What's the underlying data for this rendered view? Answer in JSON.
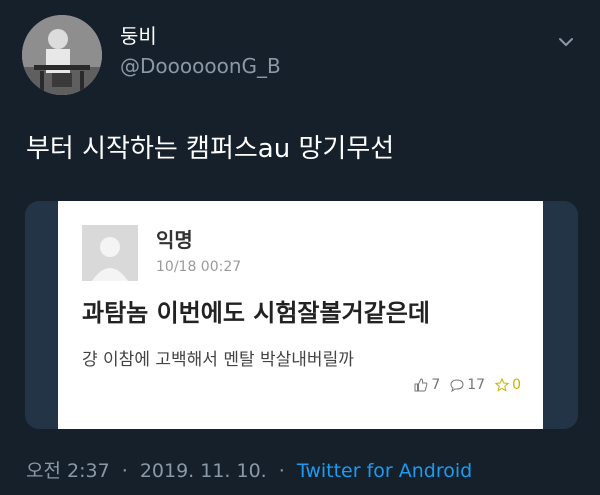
{
  "user": {
    "display_name": "둥비",
    "handle": "@DoooooonG_B"
  },
  "tweet": {
    "text": "부터 시작하는 캠퍼스au 망기무선",
    "time": "오전 2:37",
    "date": "2019. 11. 10.",
    "via": "Twitter for Android"
  },
  "card": {
    "author": "익명",
    "date": "10/18 00:27",
    "title": "과탐놈 이번에도 시험잘볼거같은데",
    "body": "걍 이참에 고백해서 멘탈 박살내버릴까",
    "likes": "7",
    "comments": "17",
    "scraps": "0"
  },
  "icons": {
    "menu": "chevron-down-icon",
    "likes": "thumbs-up-icon",
    "comments": "speech-bubble-icon",
    "scraps": "star-icon"
  },
  "colors": {
    "background": "#15202b",
    "text": "#e7e9ea",
    "muted": "#8b98a5",
    "link": "#1d9bf0",
    "card_frame": "#243447"
  }
}
